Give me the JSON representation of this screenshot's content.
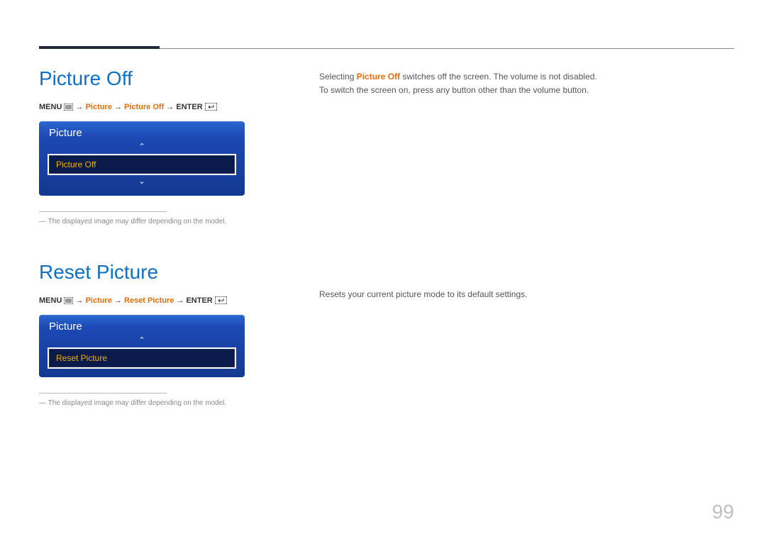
{
  "pageNumber": "99",
  "section1": {
    "heading": "Picture Off",
    "menuPath": {
      "menu": "MENU",
      "arrow": " → ",
      "level1": "Picture",
      "level2": "Picture Off",
      "enter": "ENTER"
    },
    "osd": {
      "title": "Picture",
      "item": "Picture Off",
      "showUp": true,
      "showDown": true
    },
    "footnote": "The displayed image may differ depending on the model.",
    "body_line1_pre": "Selecting ",
    "body_line1_em": "Picture Off",
    "body_line1_post": " switches off the screen. The volume is not disabled.",
    "body_line2": "To switch the screen on, press any button other than the volume button."
  },
  "section2": {
    "heading": "Reset Picture",
    "menuPath": {
      "menu": "MENU",
      "arrow": " → ",
      "level1": "Picture",
      "level2": "Reset Picture",
      "enter": "ENTER"
    },
    "osd": {
      "title": "Picture",
      "item": "Reset Picture",
      "showUp": true,
      "showDown": false
    },
    "footnote": "The displayed image may differ depending on the model.",
    "body": "Resets your current picture mode to its default settings."
  }
}
